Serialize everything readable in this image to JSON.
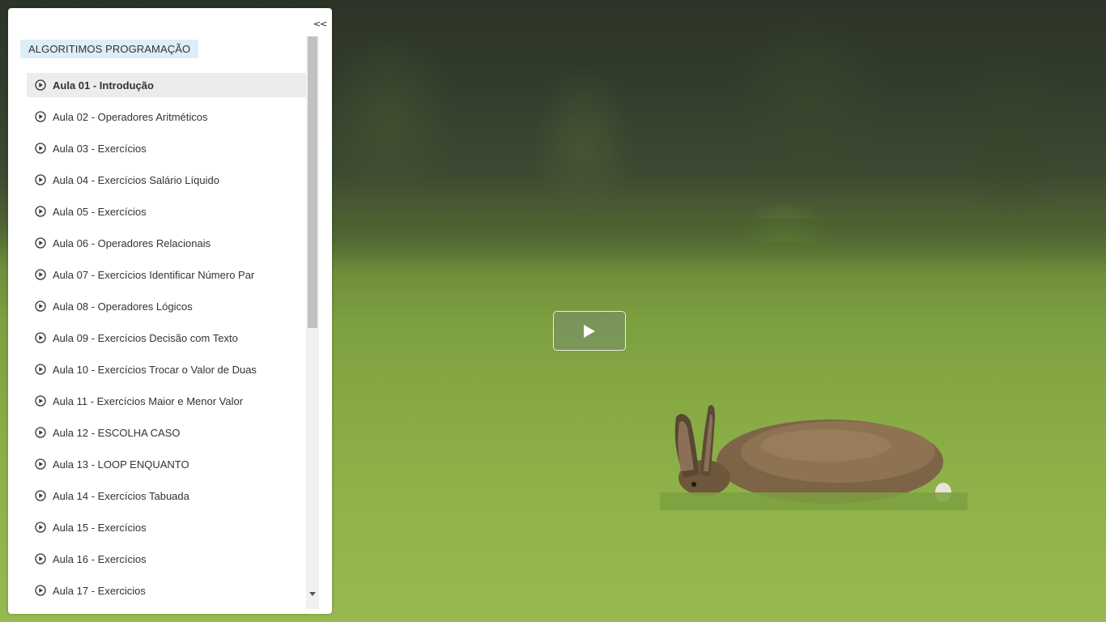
{
  "sidebar": {
    "collapse_label": "<<",
    "course_title": "ALGORITIMOS PROGRAMAÇÃO",
    "lessons": [
      {
        "label": "Aula 01 - Introdução",
        "active": true
      },
      {
        "label": "Aula 02 - Operadores Aritméticos",
        "active": false
      },
      {
        "label": "Aula 03 - Exercícios",
        "active": false
      },
      {
        "label": "Aula 04 - Exercícios Salário Líquido",
        "active": false
      },
      {
        "label": "Aula 05 - Exercícios",
        "active": false
      },
      {
        "label": "Aula 06 - Operadores Relacionais",
        "active": false
      },
      {
        "label": "Aula 07 - Exercícios Identificar Número Par",
        "active": false
      },
      {
        "label": "Aula 08 - Operadores Lógicos",
        "active": false
      },
      {
        "label": "Aula 09 - Exercícios Decisão com Texto",
        "active": false
      },
      {
        "label": "Aula 10 - Exercícios Trocar o Valor de Duas",
        "active": false
      },
      {
        "label": "Aula 11 - Exercícios Maior e Menor Valor",
        "active": false
      },
      {
        "label": "Aula 12 - ESCOLHA CASO",
        "active": false
      },
      {
        "label": "Aula 13 - LOOP ENQUANTO",
        "active": false
      },
      {
        "label": "Aula 14 - Exercícios Tabuada",
        "active": false
      },
      {
        "label": "Aula 15 - Exercícios",
        "active": false
      },
      {
        "label": "Aula 16 - Exercícios",
        "active": false
      },
      {
        "label": "Aula 17 - Exercicios",
        "active": false
      }
    ],
    "lesson_icon": "play-circle-icon"
  },
  "player": {
    "play_icon": "play-icon"
  },
  "colors": {
    "course_title_bg": "#deeef8",
    "active_item_bg": "#ececec",
    "text": "#333333"
  }
}
